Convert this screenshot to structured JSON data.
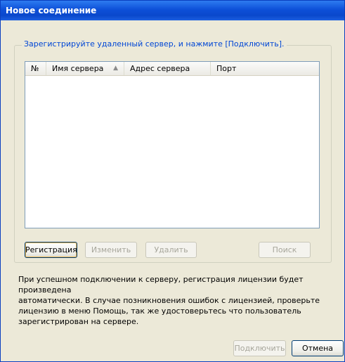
{
  "window": {
    "title": "Новое соединение"
  },
  "group": {
    "legend": "Зарегистрируйте удаленный сервер, и нажмите [Подключить]."
  },
  "table": {
    "columns": [
      "№",
      "Имя сервера",
      "Адрес сервера",
      "Порт"
    ],
    "rows": []
  },
  "buttons": {
    "register": "Регистрация",
    "edit": "Изменить",
    "delete": "Удалить",
    "search": "Поиск",
    "connect": "Подключить",
    "cancel": "Отмена"
  },
  "info": {
    "lines": [
      "При успешном подключении к серверу, регистрация лицензии будет произведена",
      "автоматически. В случае позникновения ошибок с лицензией,  проверьте",
      "лицензию в меню Помощь, так же удостоверьтесь что пользователь",
      "зарегистрирован на сервере."
    ]
  },
  "colors": {
    "title_bar": "#0a48cc",
    "legend_text": "#0046d5",
    "dialog_bg": "#ece9d8"
  }
}
